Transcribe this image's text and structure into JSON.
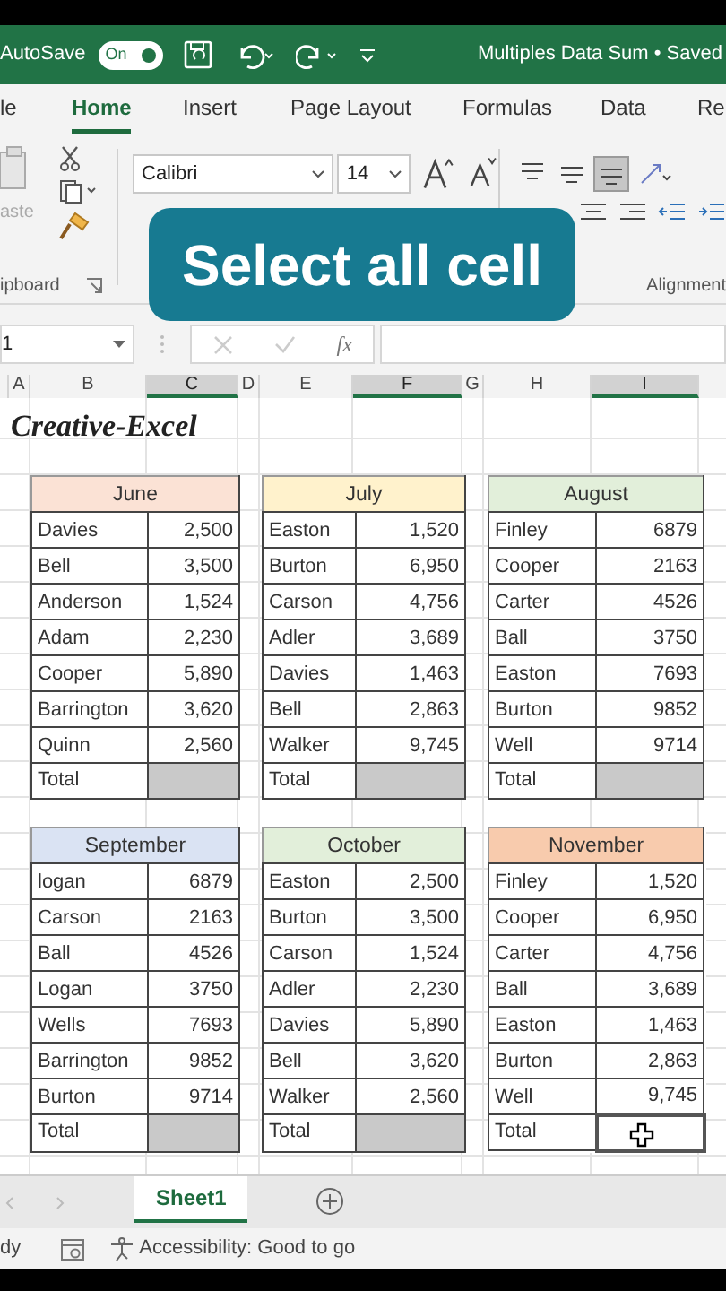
{
  "title_bar": {
    "autosave_label": "AutoSave",
    "toggle_label": "On",
    "autosave_on": true,
    "document_title": "Multiples Data Sum • Saved"
  },
  "ribbon_tabs": [
    {
      "label": "le",
      "selected": false
    },
    {
      "label": "Home",
      "selected": true
    },
    {
      "label": "Insert",
      "selected": false
    },
    {
      "label": "Page Layout",
      "selected": false
    },
    {
      "label": "Formulas",
      "selected": false
    },
    {
      "label": "Data",
      "selected": false
    },
    {
      "label": "Re",
      "selected": false
    }
  ],
  "ribbon": {
    "paste_label": "aste",
    "clipboard_group": "ipboard",
    "font_name": "Calibri",
    "font_size": "14",
    "alignment_group": "Alignment",
    "alignment_buttons": [
      {
        "kind": "top",
        "selected": false
      },
      {
        "kind": "middle",
        "selected": false
      },
      {
        "kind": "bottom",
        "selected": true
      },
      {
        "kind": "orientation",
        "selected": false
      }
    ]
  },
  "caption": "Select all cell",
  "formula_bar": {
    "name_box": "1",
    "function_label": "fx"
  },
  "columns": [
    {
      "label": "A",
      "selected": false
    },
    {
      "label": "B",
      "selected": false
    },
    {
      "label": "C",
      "selected": true
    },
    {
      "label": "D",
      "selected": false
    },
    {
      "label": "E",
      "selected": false
    },
    {
      "label": "F",
      "selected": true
    },
    {
      "label": "G",
      "selected": false
    },
    {
      "label": "H",
      "selected": false
    },
    {
      "label": "I",
      "selected": true
    }
  ],
  "sheet_title": "Creative-Excel",
  "tables": [
    {
      "month": "June",
      "color": "#fbe2d5",
      "total_label": "Total",
      "total_selected": false,
      "rows": [
        {
          "name": "Davies",
          "value": "2,500"
        },
        {
          "name": "Bell",
          "value": "3,500"
        },
        {
          "name": "Anderson",
          "value": "1,524"
        },
        {
          "name": "Adam",
          "value": "2,230"
        },
        {
          "name": "Cooper",
          "value": "5,890"
        },
        {
          "name": "Barrington",
          "value": "3,620"
        },
        {
          "name": "Quinn",
          "value": "2,560"
        }
      ]
    },
    {
      "month": "July",
      "color": "#fff2cc",
      "total_label": "Total",
      "total_selected": false,
      "rows": [
        {
          "name": "Easton",
          "value": "1,520"
        },
        {
          "name": "Burton",
          "value": "6,950"
        },
        {
          "name": "Carson",
          "value": "4,756"
        },
        {
          "name": "Adler",
          "value": "3,689"
        },
        {
          "name": "Davies",
          "value": "1,463"
        },
        {
          "name": "Bell",
          "value": "2,863"
        },
        {
          "name": "Walker",
          "value": "9,745"
        }
      ]
    },
    {
      "month": "August",
      "color": "#e2efda",
      "total_label": "Total",
      "total_selected": false,
      "rows": [
        {
          "name": "Finley",
          "value": "6879"
        },
        {
          "name": "Cooper",
          "value": "2163"
        },
        {
          "name": "Carter",
          "value": "4526"
        },
        {
          "name": "Ball",
          "value": "3750"
        },
        {
          "name": "Easton",
          "value": "7693"
        },
        {
          "name": "Burton",
          "value": "9852"
        },
        {
          "name": "Well",
          "value": "9714"
        }
      ]
    },
    {
      "month": "September",
      "color": "#dae3f3",
      "total_label": "Total",
      "total_selected": false,
      "rows": [
        {
          "name": "logan",
          "value": "6879"
        },
        {
          "name": "Carson",
          "value": "2163"
        },
        {
          "name": "Ball",
          "value": "4526"
        },
        {
          "name": "Logan",
          "value": "3750"
        },
        {
          "name": "Wells",
          "value": "7693"
        },
        {
          "name": "Barrington",
          "value": "9852"
        },
        {
          "name": "Burton",
          "value": "9714"
        }
      ]
    },
    {
      "month": "October",
      "color": "#e2efda",
      "total_label": "Total",
      "total_selected": false,
      "rows": [
        {
          "name": "Easton",
          "value": "2,500"
        },
        {
          "name": "Burton",
          "value": "3,500"
        },
        {
          "name": "Carson",
          "value": "1,524"
        },
        {
          "name": "Adler",
          "value": "2,230"
        },
        {
          "name": "Davies",
          "value": "5,890"
        },
        {
          "name": "Bell",
          "value": "3,620"
        },
        {
          "name": "Walker",
          "value": "2,560"
        }
      ]
    },
    {
      "month": "November",
      "color": "#f8cbad",
      "total_label": "Total",
      "total_selected": true,
      "rows": [
        {
          "name": "Finley",
          "value": "1,520"
        },
        {
          "name": "Cooper",
          "value": "6,950"
        },
        {
          "name": "Carter",
          "value": "4,756"
        },
        {
          "name": "Ball",
          "value": "3,689"
        },
        {
          "name": "Easton",
          "value": "1,463"
        },
        {
          "name": "Burton",
          "value": "2,863"
        },
        {
          "name": "Well",
          "value": "9,745"
        }
      ]
    }
  ],
  "sheet_tabs": [
    {
      "label": "Sheet1",
      "selected": true
    }
  ],
  "status_bar": {
    "mode": "dy",
    "accessibility": "Accessibility: Good to go"
  }
}
